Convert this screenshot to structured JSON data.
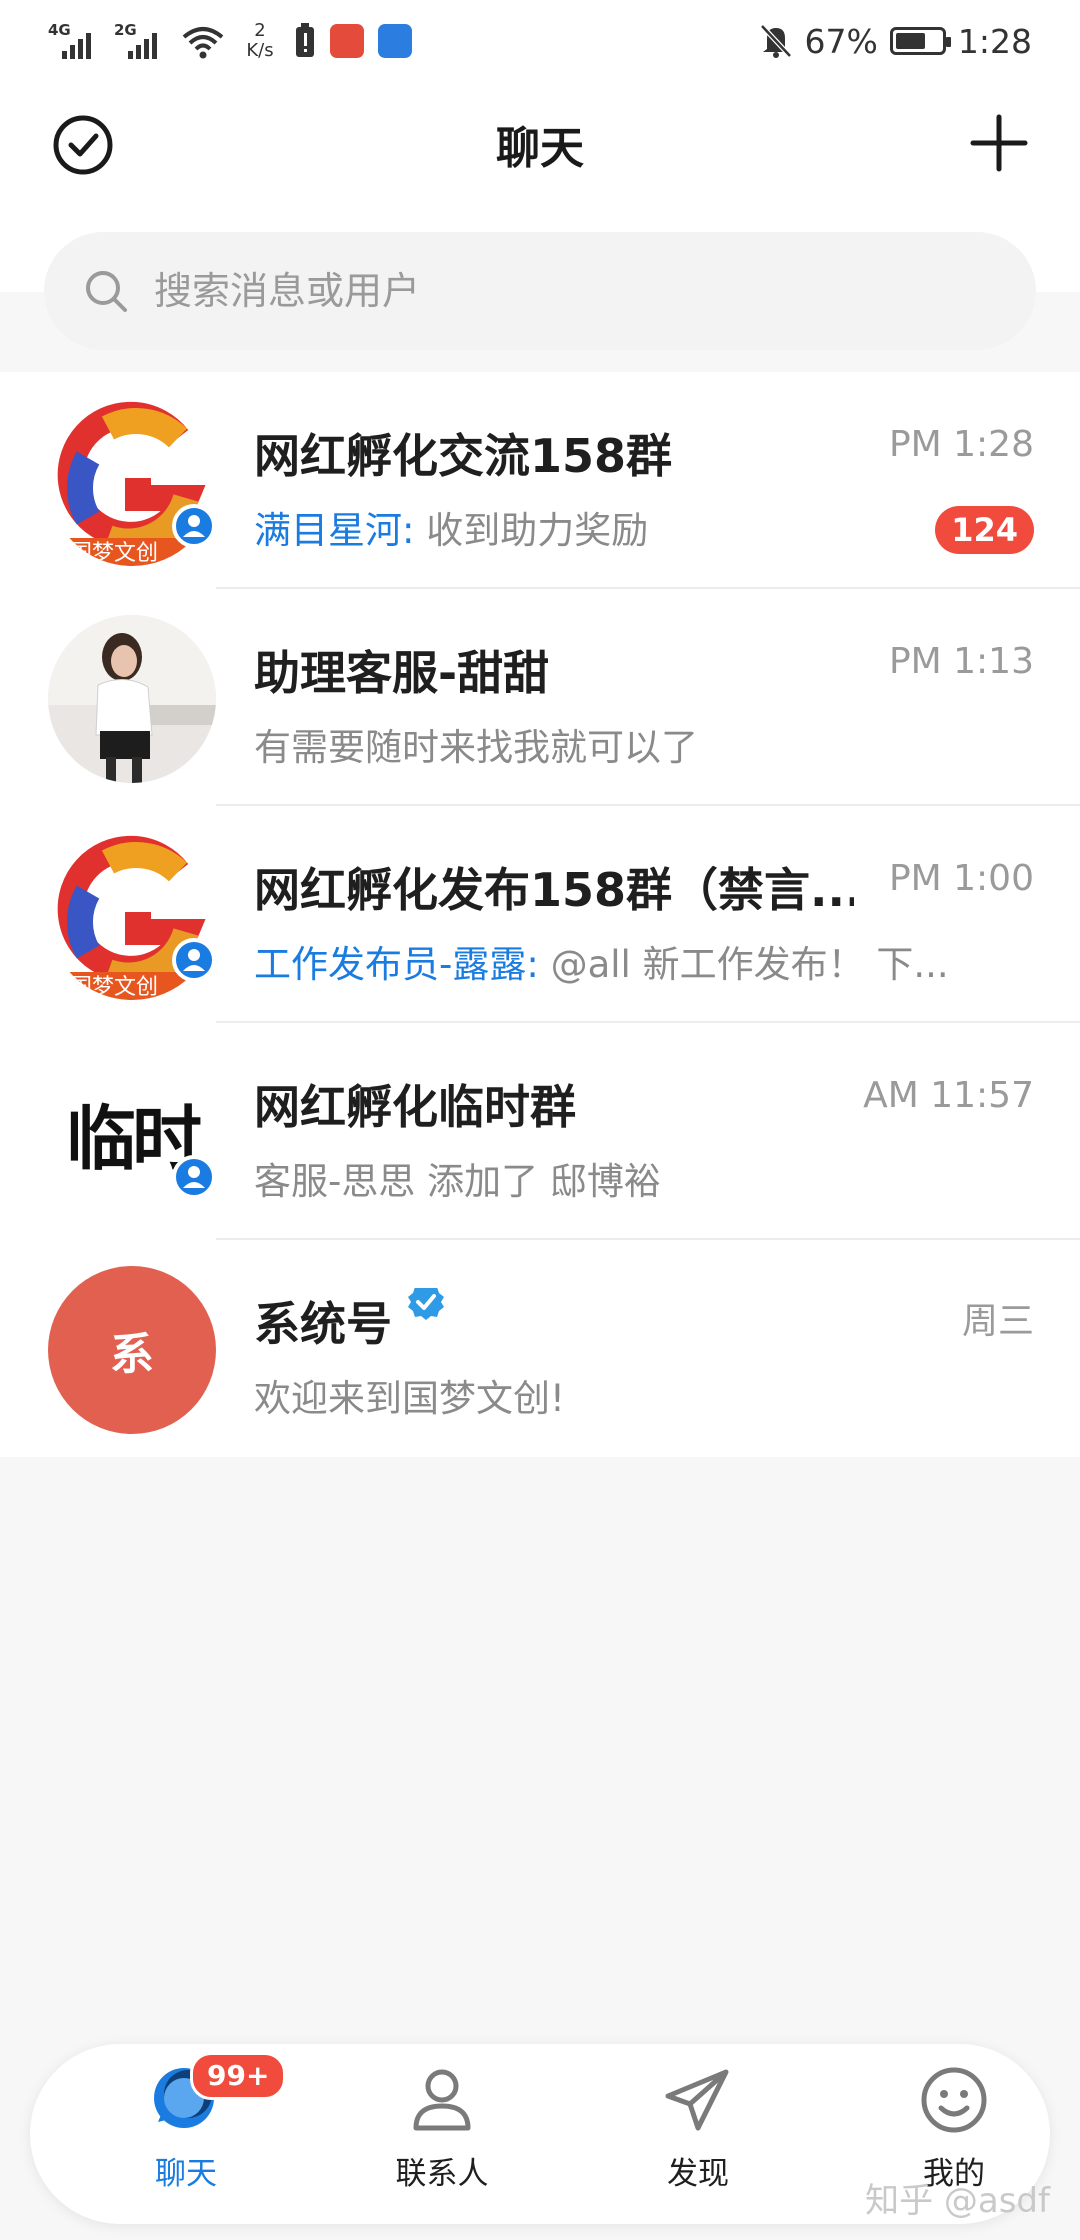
{
  "status_bar": {
    "signal1": "4G",
    "signal2": "2G",
    "speed_value": "2",
    "speed_unit": "K/s",
    "battery": "67%",
    "battery_level": 0.67,
    "time": "1:28"
  },
  "header": {
    "title": "聊天",
    "search_placeholder": "搜索消息或用户"
  },
  "chats": [
    {
      "name": "网红孵化交流158群",
      "time": "PM 1:28",
      "sender": "满目星河:",
      "message": " 收到助力奖励",
      "unread": "124"
    },
    {
      "name": "助理客服-甜甜",
      "time": "PM 1:13",
      "sender": "",
      "message": "有需要随时来找我就可以了",
      "unread": ""
    },
    {
      "name": "网红孵化发布158群（禁言...",
      "time": "PM 1:00",
      "sender": "工作发布员-露露:",
      "message": " @all 新工作发布！ 下...",
      "unread": ""
    },
    {
      "name": "网红孵化临时群",
      "time": "AM 11:57",
      "sender": "",
      "message": "客服-思思 添加了 邸博裕",
      "unread": "",
      "avatar_text": "临时"
    },
    {
      "name": "系统号",
      "time": "周三",
      "sender": "",
      "message": "欢迎来到国梦文创!",
      "unread": "",
      "avatar_text": "系"
    }
  ],
  "logo_text": "国梦文创",
  "bottom_nav": {
    "chat": "聊天",
    "chat_badge": "99+",
    "contacts": "联系人",
    "discover": "发现",
    "me": "我的"
  },
  "watermark": "知乎 @asdf",
  "colors": {
    "accent": "#1a7be0",
    "badge": "#f04b3d",
    "system_avatar": "#e2604f"
  }
}
